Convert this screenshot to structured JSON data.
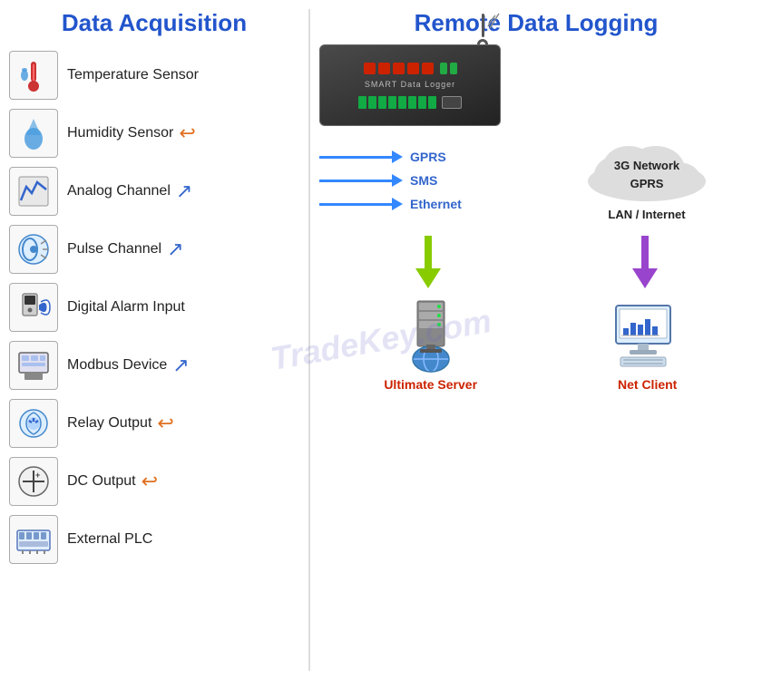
{
  "left": {
    "title": "Data Acquisition",
    "items": [
      {
        "id": "temp-sensor",
        "label": "Temperature Sensor",
        "arrow": null,
        "icon": "🌡️"
      },
      {
        "id": "humidity-sensor",
        "label": "Humidity Sensor",
        "arrow": "orange-left",
        "icon": "💧"
      },
      {
        "id": "analog-channel",
        "label": "Analog Channel",
        "arrow": "blue-right",
        "icon": "📈"
      },
      {
        "id": "pulse-channel",
        "label": "Pulse Channel",
        "arrow": "blue-right",
        "icon": "⚙️"
      },
      {
        "id": "digital-alarm",
        "label": "Digital Alarm Input",
        "arrow": null,
        "icon": "🔔"
      },
      {
        "id": "modbus-device",
        "label": "Modbus Device",
        "arrow": "blue-right",
        "icon": "📟"
      },
      {
        "id": "relay-output",
        "label": "Relay Output",
        "arrow": "orange-left",
        "icon": "🔄"
      },
      {
        "id": "dc-output",
        "label": "DC Output",
        "arrow": "orange-left",
        "icon": "⊕"
      },
      {
        "id": "external-plc",
        "label": "External PLC",
        "arrow": null,
        "icon": "🖥️"
      }
    ]
  },
  "right": {
    "title": "Remote Data Logging",
    "device_label": "SMART Data Logger",
    "connections": [
      {
        "id": "gprs",
        "label": "GPRS"
      },
      {
        "id": "sms",
        "label": "SMS"
      },
      {
        "id": "ethernet",
        "label": "Ethernet"
      }
    ],
    "cloud": {
      "line1": "3G Network",
      "line2": "GPRS",
      "line3": "LAN / Internet"
    },
    "bottom": {
      "server_label": "Ultimate Server",
      "client_label": "Net Client"
    }
  },
  "watermark": "TradeKey.com"
}
